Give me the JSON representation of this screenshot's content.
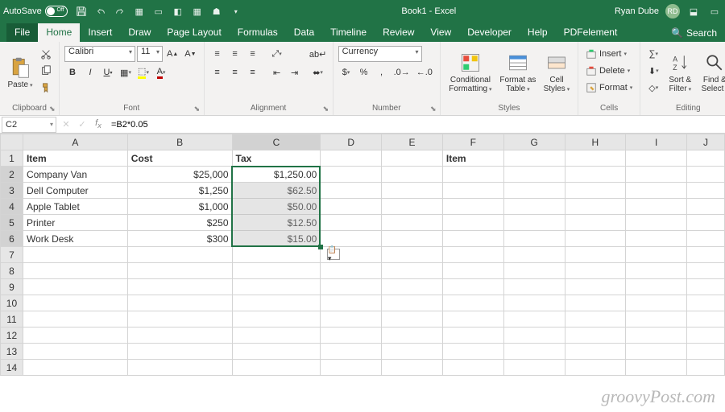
{
  "titlebar": {
    "autosave_label": "AutoSave",
    "autosave_state": "Off",
    "doc_title": "Book1 - Excel",
    "user_name": "Ryan Dube",
    "user_initials": "RD"
  },
  "menu": {
    "tabs": [
      "File",
      "Home",
      "Insert",
      "Draw",
      "Page Layout",
      "Formulas",
      "Data",
      "Timeline",
      "Review",
      "View",
      "Developer",
      "Help",
      "PDFelement"
    ],
    "active": "Home",
    "search_placeholder": "Search"
  },
  "ribbon": {
    "clipboard": {
      "label": "Clipboard",
      "paste": "Paste"
    },
    "font": {
      "label": "Font",
      "name": "Calibri",
      "size": "11"
    },
    "alignment": {
      "label": "Alignment"
    },
    "number": {
      "label": "Number",
      "format": "Currency"
    },
    "styles": {
      "label": "Styles",
      "conditional": "Conditional Formatting",
      "table": "Format as Table",
      "cell": "Cell Styles"
    },
    "cells": {
      "label": "Cells",
      "insert": "Insert",
      "delete": "Delete",
      "format": "Format"
    },
    "editing": {
      "label": "Editing",
      "sort": "Sort & Filter",
      "find": "Find & Select"
    }
  },
  "formulabar": {
    "namebox": "C2",
    "formula": "=B2*0.05"
  },
  "sheet": {
    "cols": [
      "A",
      "B",
      "C",
      "D",
      "E",
      "F",
      "G",
      "H",
      "I",
      "J"
    ],
    "rows": [
      1,
      2,
      3,
      4,
      5,
      6,
      7,
      8,
      9,
      10,
      11,
      12,
      13,
      14
    ],
    "headers": {
      "A1": "Item",
      "B1": "Cost",
      "C1": "Tax",
      "F1": "Item"
    },
    "data": [
      {
        "A": "Company Van",
        "B": "$25,000",
        "C": "$1,250.00"
      },
      {
        "A": "Dell Computer",
        "B": "$1,250",
        "C": "$62.50"
      },
      {
        "A": "Apple Tablet",
        "B": "$1,000",
        "C": "$50.00"
      },
      {
        "A": "Printer",
        "B": "$250",
        "C": "$12.50"
      },
      {
        "A": "Work Desk",
        "B": "$300",
        "C": "$15.00"
      }
    ],
    "selected_col": "C",
    "selected_rows": [
      2,
      3,
      4,
      5,
      6
    ]
  },
  "watermark": "groovyPost.com"
}
